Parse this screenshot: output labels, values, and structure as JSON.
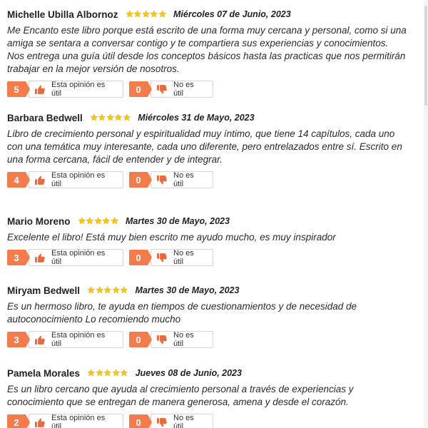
{
  "reviews": [
    {
      "name": "Michelle Ubilla Albornoz",
      "rating": 5,
      "date": "Miércoles 07 de Junio, 2023",
      "text": "Me Encanto este libro porque está escrito de una forma muy cercana y personal, como si una amiga se sentara a conversar contigo y te compartiera sus experiencias y conocimientos. Nos entrega una guía útil desde los conceptos básicos hasta las practicas que nos permitirán trabajar en la mejor versión de nosotros.",
      "useful_count": "5",
      "not_useful_count": "0"
    },
    {
      "name": "Barbara Bedwell",
      "rating": 5,
      "date": "Miércoles 31 de Mayo, 2023",
      "text": "Libro de crecimiento personal y espiritualidad muy íntimo, que tiene 14 capítulos, cada uno con una temática muy interesante, cada uno diferente, pero entrelazados entre sí. Escrito en una forma cercana, fácil de entender y de integrar.",
      "useful_count": "4",
      "not_useful_count": "0"
    },
    {
      "name": "Mario Moreno",
      "rating": 5,
      "date": "Martes 30 de Mayo, 2023",
      "text": "Excelente el libro! Está muy bien escrito me ayudo mucho, es muy inspirador",
      "useful_count": "3",
      "not_useful_count": "0"
    },
    {
      "name": "Miryam Bedwell",
      "rating": 5,
      "date": "Martes 30 de Mayo, 2023",
      "text": "Es un hermoso libro, te ayuda en tiempos de cuestionamientos y de necesidad de autoconocimiento Lo recomiendo mucho",
      "useful_count": "3",
      "not_useful_count": "0"
    },
    {
      "name": "Pamela Morales",
      "rating": 5,
      "date": "Jueves 08 de Junio, 2023",
      "text": "Es un libro cercano que ayuda al crecimiento personal a través de experiencias y conocimiento que se entregan de manera generosa, amena y desde el corazón.",
      "useful_count": "2",
      "not_useful_count": "0"
    }
  ],
  "labels": {
    "useful": "Esta opinión es útil",
    "not_useful": "No es útil"
  },
  "icons": {
    "star": "star-icon",
    "thumbs_up": "thumbs-up-icon",
    "thumbs_down": "thumbs-down-icon"
  },
  "colors": {
    "accent": "#f47c4c",
    "star": "#f5c518",
    "thumb": "#ea6a3c"
  }
}
